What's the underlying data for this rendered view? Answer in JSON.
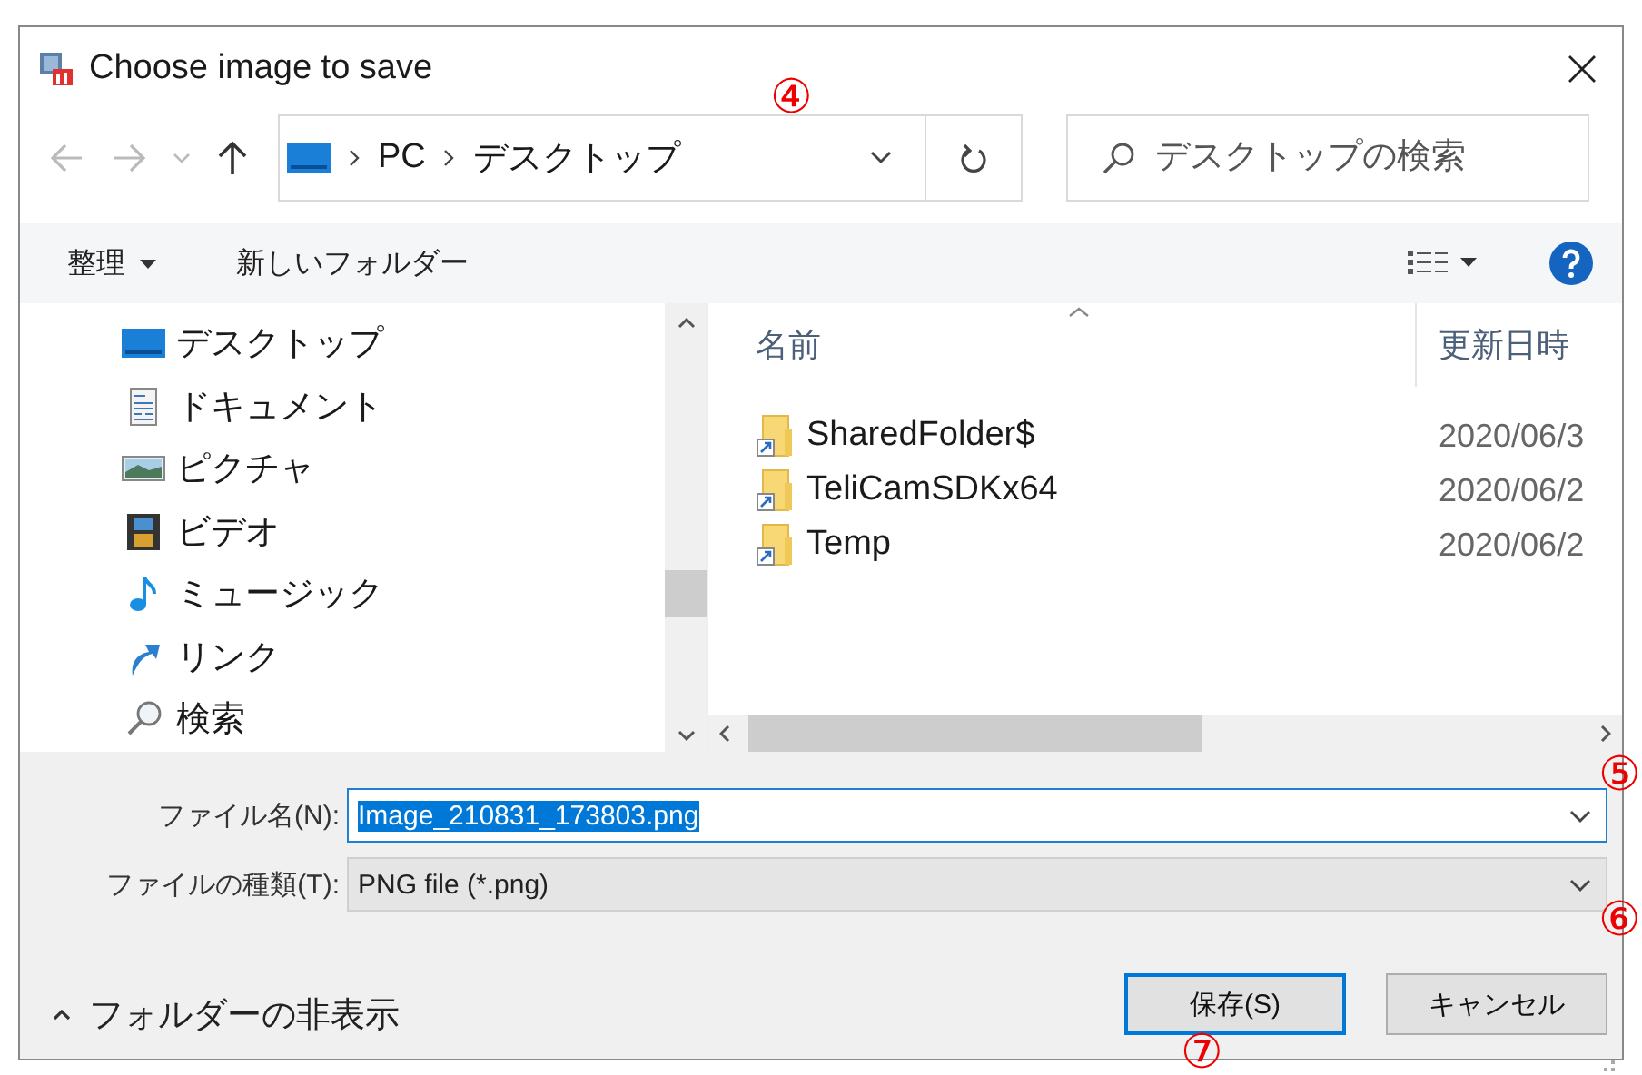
{
  "window": {
    "title": "Choose image to save"
  },
  "nav_buttons": [
    {
      "kind": "back",
      "disabled": true
    },
    {
      "kind": "forward",
      "disabled": true
    },
    {
      "kind": "recent",
      "disabled": true
    },
    {
      "kind": "up",
      "disabled": false
    }
  ],
  "address": {
    "crumbs": [
      "PC",
      "デスクトップ"
    ]
  },
  "search": {
    "placeholder": "デスクトップの検索"
  },
  "toolbar": {
    "organize": "整理",
    "new_folder": "新しいフォルダー"
  },
  "sidebar": {
    "items": [
      {
        "label": "デスクトップ",
        "kind": "desktop"
      },
      {
        "label": "ドキュメント",
        "kind": "document"
      },
      {
        "label": "ピクチャ",
        "kind": "pictures"
      },
      {
        "label": "ビデオ",
        "kind": "video"
      },
      {
        "label": "ミュージック",
        "kind": "music"
      },
      {
        "label": "リンク",
        "kind": "link"
      },
      {
        "label": "検索",
        "kind": "search"
      }
    ]
  },
  "file_list": {
    "columns": [
      "名前",
      "更新日時"
    ],
    "rows": [
      {
        "name": "SharedFolder$",
        "date": "2020/06/3"
      },
      {
        "name": "TeliCamSDKx64",
        "date": "2020/06/2"
      },
      {
        "name": "Temp",
        "date": "2020/06/2"
      }
    ]
  },
  "form": {
    "file_name": {
      "label": "ファイル名(N):",
      "value": "Image_210831_173803.png",
      "selected": true
    },
    "file_type": {
      "label": "ファイルの種類(T):",
      "value": "PNG file (*.png)"
    }
  },
  "footer": {
    "toggle": "フォルダーの非表示",
    "buttons": [
      {
        "label": "保存(S)",
        "default": true
      },
      {
        "label": "キャンセル",
        "default": false
      }
    ]
  },
  "annotations": [
    {
      "text": "④"
    },
    {
      "text": "⑤"
    },
    {
      "text": "⑥"
    },
    {
      "text": "⑦"
    }
  ]
}
